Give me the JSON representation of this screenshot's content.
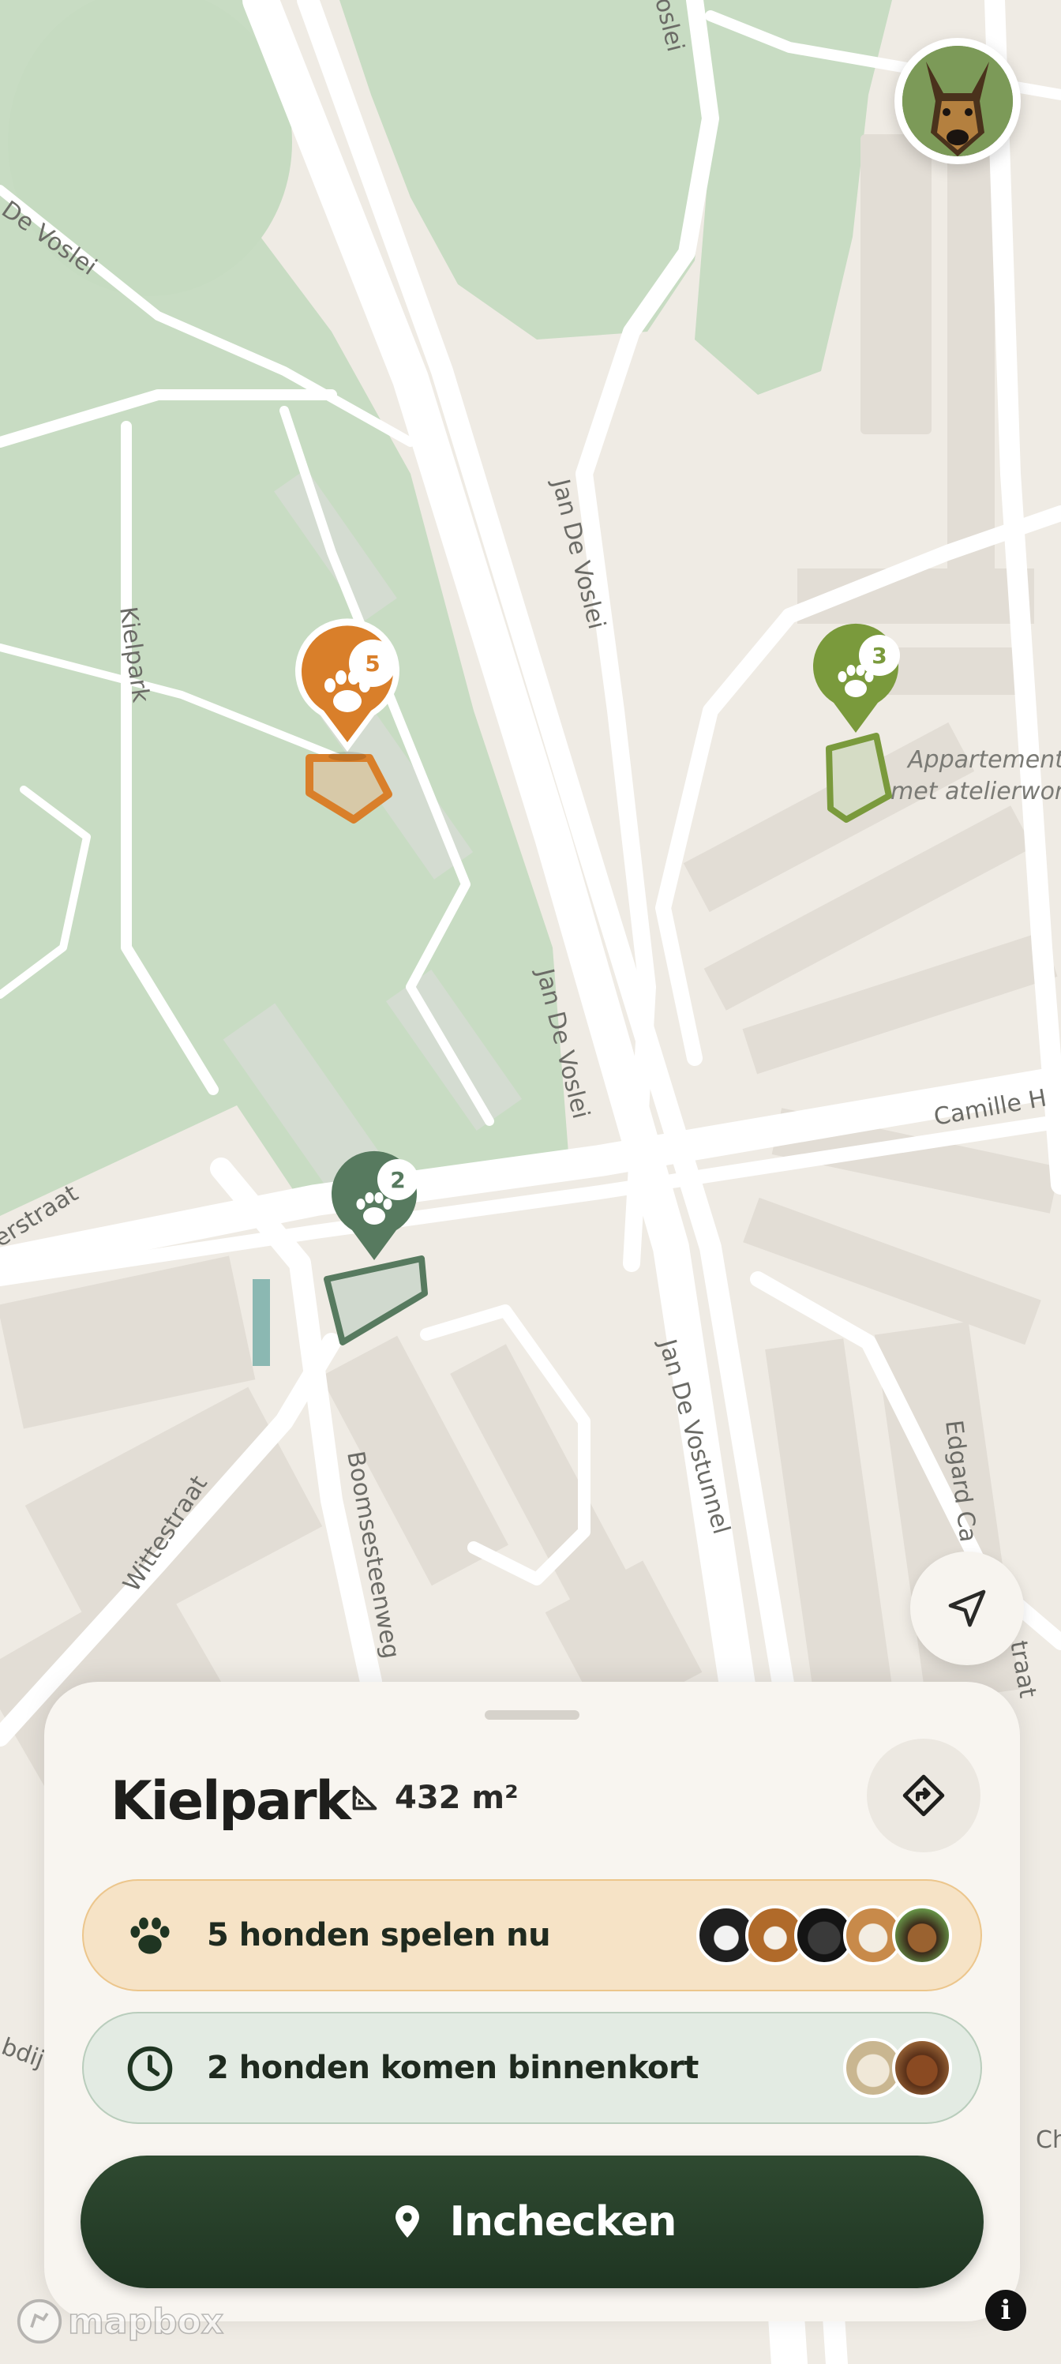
{
  "map": {
    "street_labels": [
      "De Voslei",
      "Jan De Voslei",
      "Jan De Voslei",
      "Kielpark",
      "Jan De Vostunnel",
      "Camille H",
      "Wittestraat",
      "Boomsesteenweg",
      "Edgard Ca",
      "traat",
      "erstraat",
      "oslei",
      "bdij",
      "Ch"
    ],
    "poi_label_lines": [
      "Appartement",
      "met atelierwon"
    ],
    "pins": [
      {
        "name": "kielpark-pin",
        "count": "5",
        "color": "#d97f2a"
      },
      {
        "name": "appartement-pin",
        "count": "3",
        "color": "#7a9a3c"
      },
      {
        "name": "boomse-pin",
        "count": "2",
        "color": "#577a5f"
      }
    ],
    "colors": {
      "park": "#c8dcc3",
      "land": "#efebe4",
      "road": "#ffffff",
      "building": "#e3ded6"
    }
  },
  "sheet": {
    "park_name": "Kielpark",
    "area": "432 m²",
    "playing": {
      "label": "5 honden spelen nu",
      "dog_count": 5
    },
    "coming": {
      "label": "2 honden komen binnenkort",
      "dog_count": 2
    },
    "checkin_label": "Inchecken"
  },
  "icons": {
    "area": "ruler-triangle-icon",
    "directions": "directions-icon",
    "paw": "paw-icon",
    "clock": "clock-icon",
    "location_pin": "location-pin-icon",
    "locate": "navigation-arrow-icon",
    "info": "info-icon"
  },
  "footer": {
    "logo_text": "mapbox",
    "info_glyph": "i"
  },
  "colors": {
    "primary": "#213a25",
    "playing_bg": "#f6e3c6",
    "coming_bg": "#e3ebe3",
    "orange": "#d97f2a"
  }
}
